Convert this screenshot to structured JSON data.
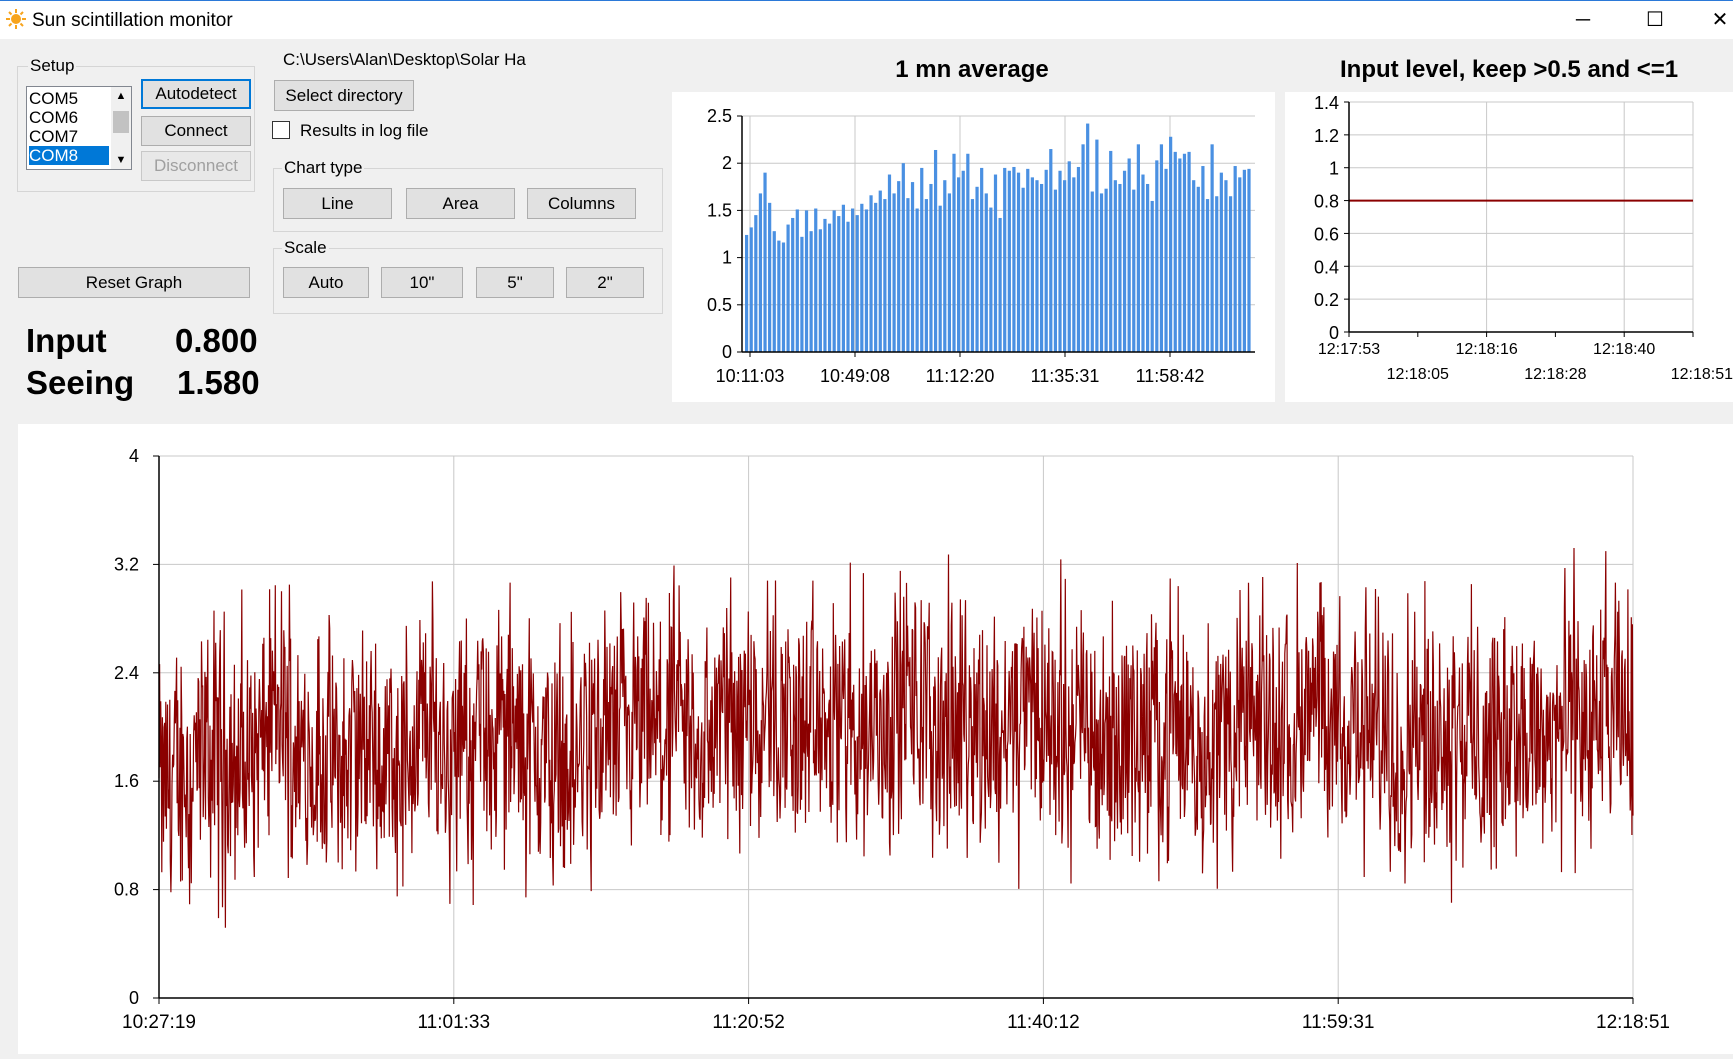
{
  "window": {
    "title": "Sun scintillation monitor",
    "controls": [
      "─",
      "☐",
      "✕"
    ]
  },
  "setup": {
    "label": "Setup",
    "ports": [
      "COM5",
      "COM6",
      "COM7",
      "COM8"
    ],
    "selected_port": "COM8",
    "autodetect_label": "Autodetect",
    "connect_label": "Connect",
    "disconnect_label": "Disconnect"
  },
  "directory": {
    "path": "C:\\Users\\Alan\\Desktop\\Solar Ha",
    "select_label": "Select directory",
    "log_label": "Results in log file",
    "log_checked": false
  },
  "chart_type": {
    "label": "Chart type",
    "options": [
      "Line",
      "Area",
      "Columns"
    ]
  },
  "scale": {
    "label": "Scale",
    "options": [
      "Auto",
      "10\"",
      "5\"",
      "2\""
    ]
  },
  "reset_label": "Reset Graph",
  "readouts": {
    "input_label": "Input",
    "input_value": "0.800",
    "seeing_label": "Seeing",
    "seeing_value": "1.580"
  },
  "colors": {
    "bar": "#4a90e2",
    "line": "#8b0000",
    "accent": "#0078d7"
  },
  "chart_data": [
    {
      "type": "bar",
      "title": "1 mn average",
      "ylim": [
        0,
        2.5
      ],
      "yticks": [
        "0",
        "0.5",
        "1",
        "1.5",
        "2",
        "2.5"
      ],
      "xtick_labels": [
        "10:11:03",
        "10:49:08",
        "11:12:20",
        "11:35:31",
        "11:58:42"
      ],
      "grid": true,
      "values": [
        1.24,
        1.32,
        1.45,
        1.68,
        1.9,
        1.58,
        1.28,
        1.18,
        1.16,
        1.35,
        1.42,
        1.51,
        1.22,
        1.5,
        1.28,
        1.52,
        1.3,
        1.41,
        1.36,
        1.5,
        1.44,
        1.56,
        1.38,
        1.52,
        1.45,
        1.57,
        1.51,
        1.66,
        1.58,
        1.71,
        1.62,
        1.88,
        1.68,
        1.81,
        2.0,
        1.63,
        1.8,
        1.52,
        1.95,
        1.62,
        1.78,
        2.14,
        1.55,
        1.82,
        1.68,
        2.1,
        1.85,
        1.92,
        2.1,
        1.62,
        1.75,
        1.95,
        1.68,
        1.53,
        1.88,
        1.42,
        1.95,
        1.92,
        1.96,
        1.9,
        1.74,
        1.94,
        1.85,
        1.82,
        1.78,
        1.93,
        2.15,
        1.72,
        1.92,
        1.82,
        2.02,
        1.85,
        1.96,
        2.2,
        2.42,
        1.7,
        2.25,
        1.68,
        1.73,
        2.13,
        1.82,
        1.78,
        1.92,
        2.05,
        1.72,
        2.2,
        1.88,
        1.78,
        1.6,
        2.03,
        2.2,
        1.94,
        2.28,
        2.12,
        2.05,
        2.1,
        2.12,
        1.82,
        1.75,
        1.97,
        1.62,
        2.2,
        1.65,
        1.9,
        1.82,
        1.65,
        1.97,
        1.85,
        1.93,
        1.94
      ],
      "bar_color": "#4a90e2"
    },
    {
      "type": "line",
      "title": "Input level, keep >0.5 and <=1",
      "ylim": [
        0,
        1.4
      ],
      "yticks": [
        "0",
        "0.2",
        "0.4",
        "0.6",
        "0.8",
        "1",
        "1.2",
        "1.4"
      ],
      "xtick_labels": [
        "12:17:53",
        "12:18:05",
        "12:18:16",
        "12:18:28",
        "12:18:40",
        "12:18:51"
      ],
      "grid": true,
      "series": [
        {
          "values": [
            0.8,
            0.8,
            0.8,
            0.8,
            0.8,
            0.8
          ]
        }
      ],
      "line_color": "#8b0000"
    },
    {
      "type": "line",
      "title": "",
      "ylim": [
        0,
        4
      ],
      "yticks": [
        "0",
        "0.8",
        "1.6",
        "2.4",
        "3.2",
        "4"
      ],
      "xtick_labels": [
        "10:27:19",
        "11:01:33",
        "11:20:52",
        "11:40:12",
        "11:59:31",
        "12:18:51"
      ],
      "grid": true,
      "baseline_profile": [
        1.6,
        1.7,
        1.8,
        1.7,
        2.1,
        1.75,
        1.7,
        1.85,
        1.8,
        2.0,
        1.8,
        2.0,
        1.9,
        1.7,
        1.8,
        2.0,
        1.9,
        2.0,
        1.9,
        2.1,
        2.2,
        2.0,
        1.9,
        2.1,
        2.0,
        2.2,
        2.0,
        2.1,
        1.9,
        2.2,
        2.0,
        2.0,
        1.9,
        2.0,
        2.0,
        1.9,
        2.0,
        2.0,
        2.1,
        2.0,
        2.0,
        1.9,
        2.0,
        2.0,
        1.9,
        2.0,
        1.9,
        2.1,
        2.0,
        2.0
      ],
      "range": [
        0.3,
        4.0
      ],
      "line_color": "#8b0000"
    }
  ]
}
